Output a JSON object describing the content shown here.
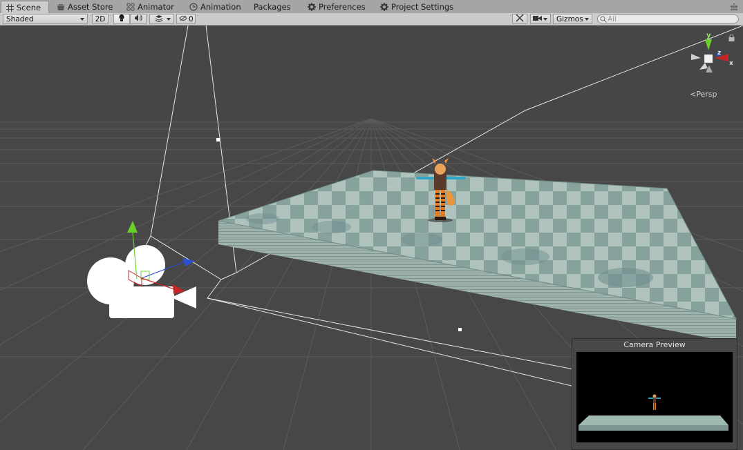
{
  "tabs": [
    {
      "label": "Scene",
      "icon": "grid-icon",
      "active": true
    },
    {
      "label": "Asset Store",
      "icon": "store-icon"
    },
    {
      "label": "Animator",
      "icon": "animator-icon"
    },
    {
      "label": "Animation",
      "icon": "clock-icon"
    },
    {
      "label": "Packages",
      "icon": ""
    },
    {
      "label": "Preferences",
      "icon": "gear-icon"
    },
    {
      "label": "Project Settings",
      "icon": "gear-icon"
    }
  ],
  "toolbar": {
    "shading_mode": "Shaded",
    "mode_2d": "2D",
    "hidden_count": "0",
    "gizmos_label": "Gizmos",
    "search_placeholder": "All"
  },
  "viewport": {
    "projection_label": "Persp",
    "axis_labels": {
      "y": "y",
      "z": "z",
      "x": "x"
    },
    "preview_title": "Camera Preview"
  },
  "colors": {
    "viewport_bg": "#474747",
    "grid_line": "#5a5a5a",
    "axis_x": "#c62626",
    "axis_y": "#6bd12a",
    "axis_z": "#2d4fd4",
    "tile_light": "#b6c9c3",
    "tile_dark": "#86a29e",
    "tab_bar": "#a5a5a5",
    "toolbar": "#cbcbcb"
  }
}
